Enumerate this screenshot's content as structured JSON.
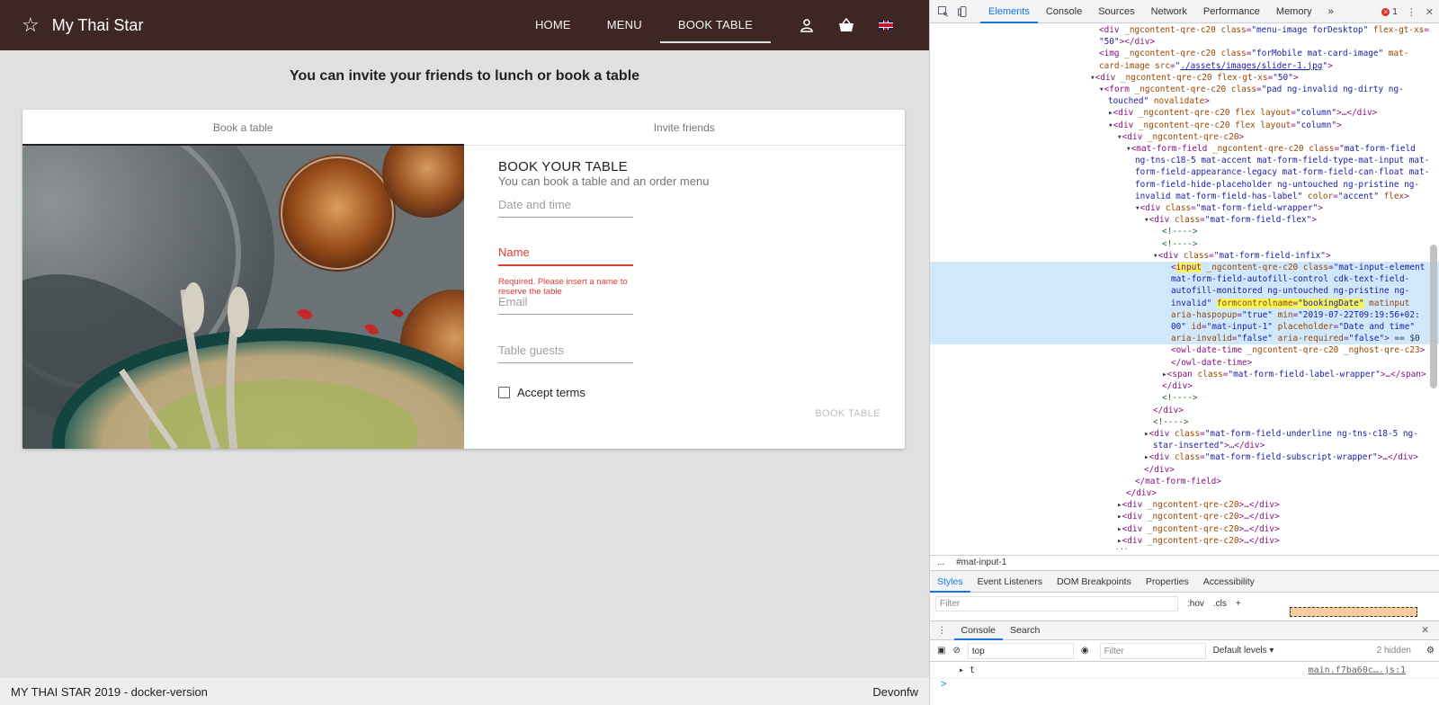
{
  "app": {
    "brand": "My Thai Star",
    "nav": [
      "HOME",
      "MENU",
      "BOOK TABLE"
    ],
    "headline": "You can invite your friends to lunch or book a table",
    "tabs": [
      "Book a table",
      "Invite friends"
    ],
    "form": {
      "title": "BOOK YOUR TABLE",
      "subtitle": "You can book a table and an order menu",
      "date_placeholder": "Date and time",
      "name_placeholder": "Name",
      "name_error": "Required. Please insert a name to reserve the table",
      "email_placeholder": "Email",
      "guests_placeholder": "Table guests",
      "terms_label": "Accept terms",
      "submit": "BOOK TABLE"
    },
    "footer": {
      "left": "MY THAI STAR 2019 - docker-version",
      "right": "Devonfw"
    },
    "colors": {
      "toolbar": "#3e2723",
      "error": "#e53935"
    }
  },
  "devtools": {
    "tabs": [
      "Elements",
      "Console",
      "Sources",
      "Network",
      "Performance",
      "Memory"
    ],
    "more": "»",
    "error_count": "1",
    "breadcrumb": "#mat-input-1",
    "ellipsis": "...",
    "style_tabs": [
      "Styles",
      "Event Listeners",
      "DOM Breakpoints",
      "Properties",
      "Accessibility"
    ],
    "styles_filter": "Filter",
    "hov": ":hov",
    "cls": ".cls",
    "console_tabs": [
      "Console",
      "Search"
    ],
    "console_context": "top",
    "console_filter": "Filter",
    "console_levels": "Default levels ▾",
    "hidden_count": "2 hidden",
    "log_text": "t",
    "log_source": "main.f7ba60c….js:1",
    "prompt": ">"
  }
}
